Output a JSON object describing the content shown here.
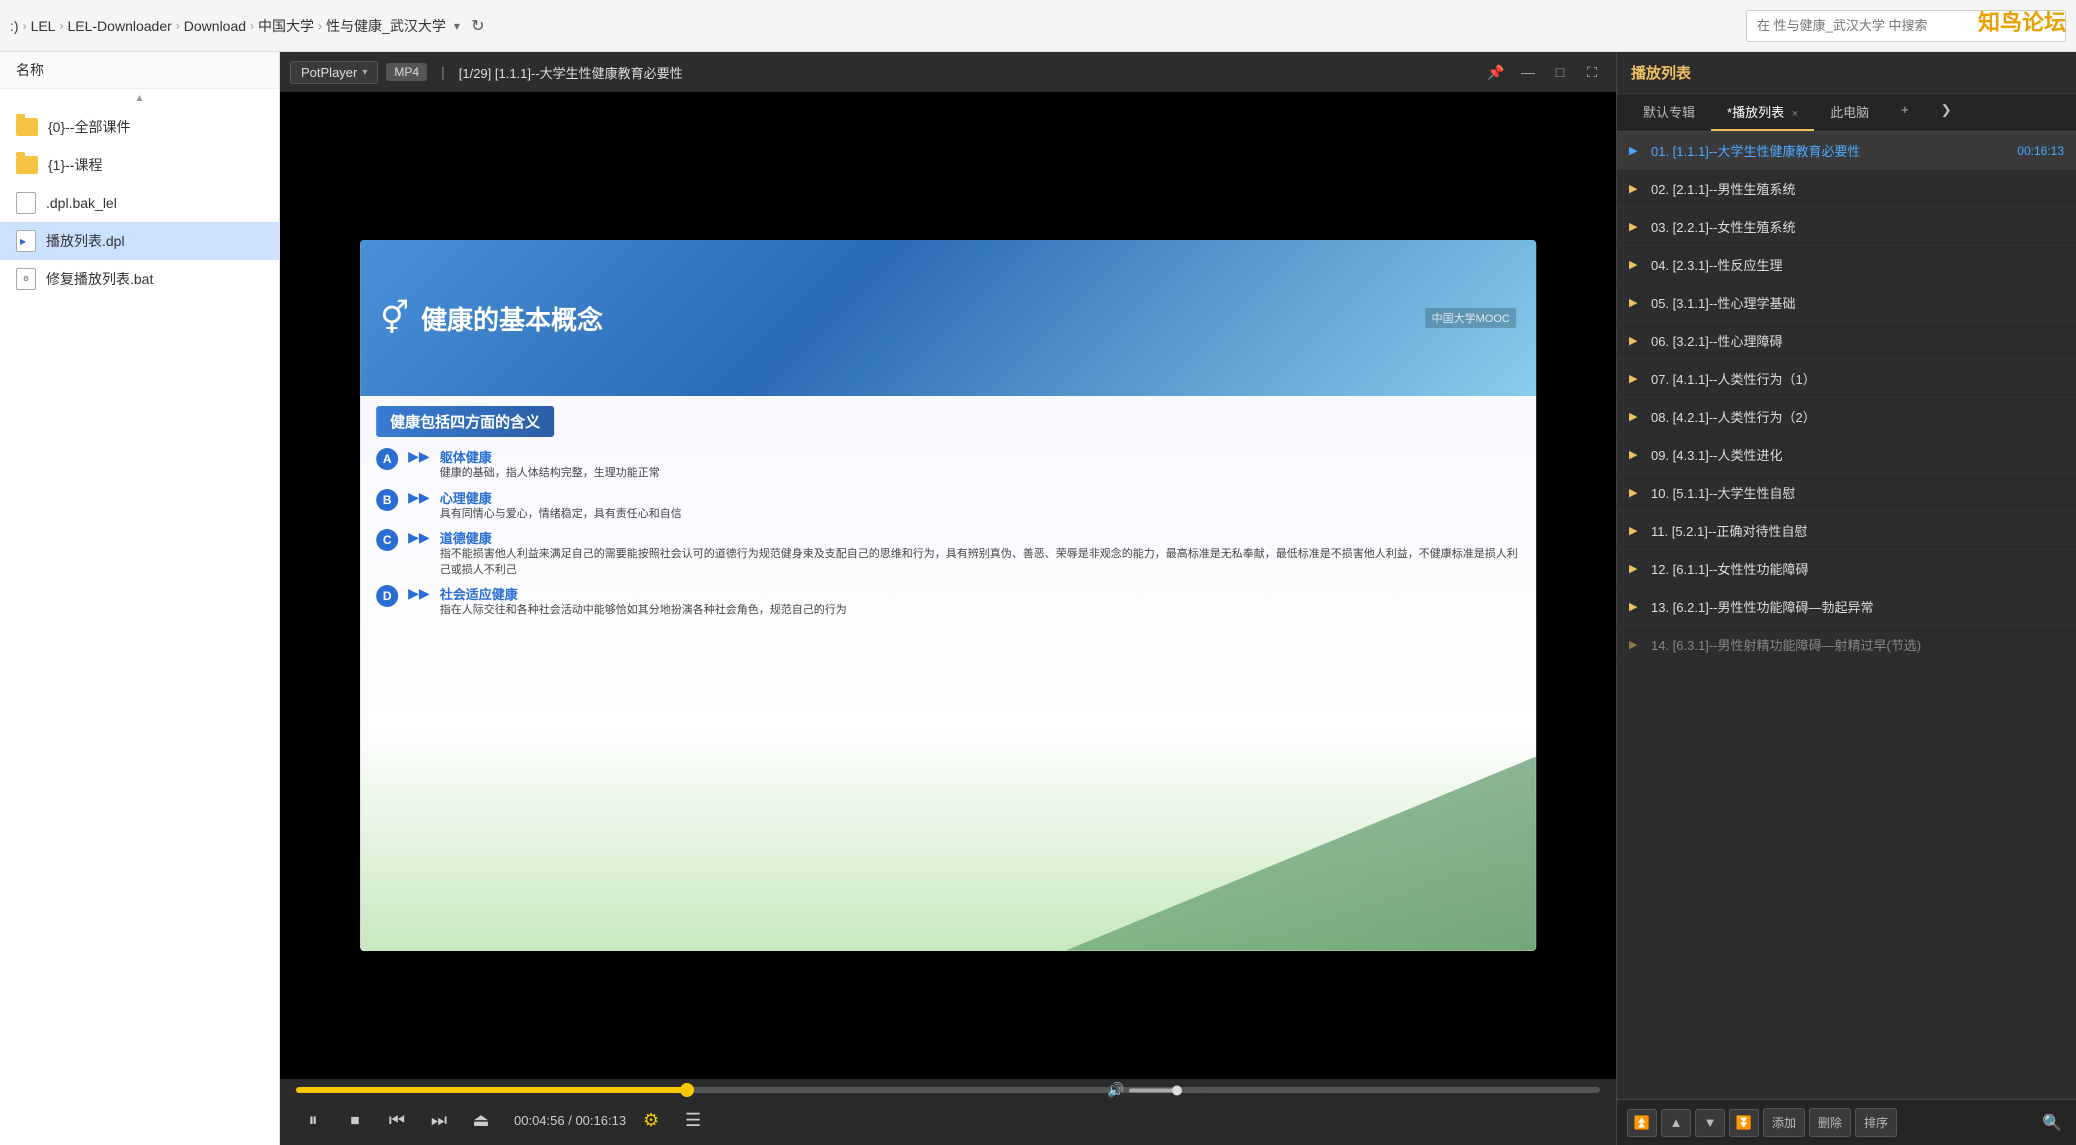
{
  "window": {
    "logo": "知鸟论坛"
  },
  "breadcrumb": {
    "items": [
      {
        "label": ":)"
      },
      {
        "label": "LEL"
      },
      {
        "label": "LEL-Downloader"
      },
      {
        "label": "Download"
      },
      {
        "label": "中国大学"
      },
      {
        "label": "性与健康_武汉大学"
      }
    ],
    "search_placeholder": "在 性与健康_武汉大学 中搜索"
  },
  "sidebar": {
    "column_header": "名称",
    "files": [
      {
        "name": "{0}--全部课件",
        "type": "folder"
      },
      {
        "name": "{1}--课程",
        "type": "folder"
      },
      {
        "name": ".dpl.bak_lel",
        "type": "file"
      },
      {
        "name": "播放列表.dpl",
        "type": "dpl"
      },
      {
        "name": "修复播放列表.bat",
        "type": "bat"
      }
    ]
  },
  "player": {
    "brand": "PotPlayer",
    "format": "MP4",
    "title": "[1/29] [1.1.1]--大学生性健康教育必要性",
    "slide": {
      "main_title": "健康的基本概念",
      "subtitle": "健康包括四方面的含义",
      "logo": "中国大学MOOC",
      "points": [
        {
          "letter": "A",
          "title": "躯体健康",
          "desc": "健康的基础，指人体结构完整，生理功能正常"
        },
        {
          "letter": "B",
          "title": "心理健康",
          "desc": "具有同情心与爱心，情绪稳定，具有责任心和自信"
        },
        {
          "letter": "C",
          "title": "道德健康",
          "desc": "指不能损害他人利益来满足自己的需要能按照社会认可的道德行为规范健身束及支配自己的思维和行为，具有辨别真伪、善恶、荣辱是非观念的能力，最高标准是无私奉献，最低标准是不损害他人利益，不健康标准是损人利己或损人不利己"
        },
        {
          "letter": "D",
          "title": "社会适应健康",
          "desc": "指在人际交往和各种社会活动中能够恰如其分地扮演各种社会角色，规范自己的行为"
        }
      ]
    },
    "controls": {
      "current_time": "00:04:56",
      "total_time": "00:16:13",
      "time_display": "00:04:56 / 00:16:13",
      "progress_pct": 30,
      "volume_pct": 60
    },
    "window_controls": {
      "pin": "📌",
      "minimize": "—",
      "maximize": "□",
      "fullscreen": "⛶"
    }
  },
  "playlist": {
    "header_title": "播放列表",
    "tabs": {
      "default_album": "默认专辑",
      "playlist": "*播放列表",
      "this_pc": "此电脑"
    },
    "items": [
      {
        "index": "01",
        "key": "1.1.1",
        "title": "大学生性健康教育必要性",
        "duration": "00:16:13",
        "active": true
      },
      {
        "index": "02",
        "key": "2.1.1",
        "title": "男性生殖系统",
        "duration": "",
        "active": false
      },
      {
        "index": "03",
        "key": "2.2.1",
        "title": "女性生殖系统",
        "duration": "",
        "active": false
      },
      {
        "index": "04",
        "key": "2.3.1",
        "title": "性反应生理",
        "duration": "",
        "active": false
      },
      {
        "index": "05",
        "key": "3.1.1",
        "title": "性心理学基础",
        "duration": "",
        "active": false
      },
      {
        "index": "06",
        "key": "3.2.1",
        "title": "性心理障碍",
        "duration": "",
        "active": false
      },
      {
        "index": "07",
        "key": "4.1.1",
        "title": "人类性行为（1）",
        "duration": "",
        "active": false
      },
      {
        "index": "08",
        "key": "4.2.1",
        "title": "人类性行为（2）",
        "duration": "",
        "active": false
      },
      {
        "index": "09",
        "key": "4.3.1",
        "title": "人类性进化",
        "duration": "",
        "active": false
      },
      {
        "index": "10",
        "key": "5.1.1",
        "title": "大学生性自慰",
        "duration": "",
        "active": false
      },
      {
        "index": "11",
        "key": "5.2.1",
        "title": "正确对待性自慰",
        "duration": "",
        "active": false
      },
      {
        "index": "12",
        "key": "6.1.1",
        "title": "女性性功能障碍",
        "duration": "",
        "active": false
      },
      {
        "index": "13",
        "key": "6.2.1",
        "title": "男性性功能障碍—勃起异常",
        "duration": "",
        "active": false
      },
      {
        "index": "14",
        "key": "6.3.1",
        "title": "男性射精功能障碍—射精过早(节选)",
        "duration": "",
        "active": false
      }
    ],
    "bottom_controls": {
      "move_top": "▲",
      "move_up": "▲",
      "move_down": "▼",
      "move_bottom": "▼",
      "add": "添加",
      "remove": "删除",
      "sort": "排序"
    }
  }
}
